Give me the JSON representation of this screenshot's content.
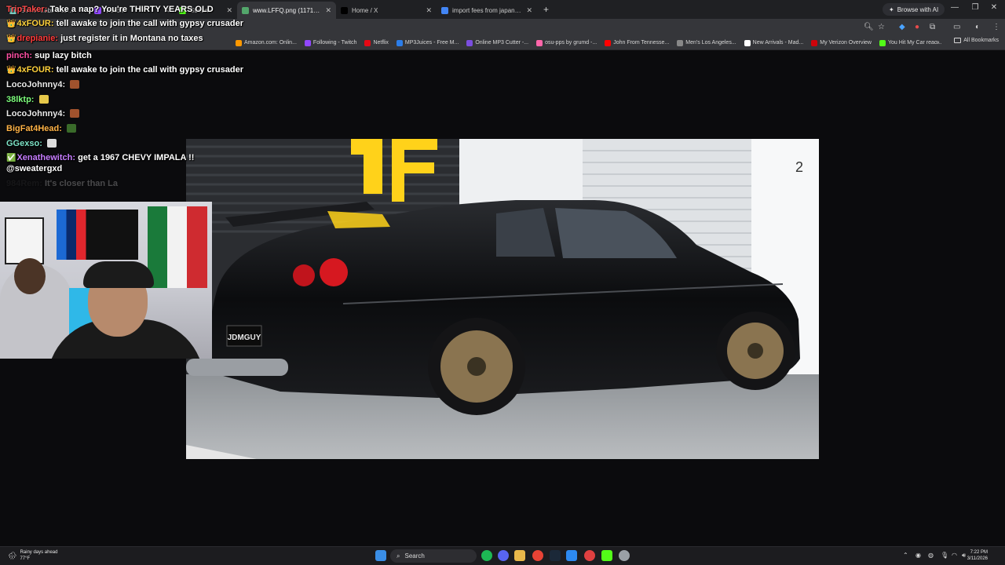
{
  "browser": {
    "tabs": [
      {
        "title": "StreamLabs Dashboard",
        "favicon_color": "#7fd3c8",
        "active": false
      },
      {
        "title": "Twitch",
        "favicon_color": "#9147ff",
        "active": false
      },
      {
        "title": "Stream",
        "favicon_color": "#53fc18",
        "active": false
      },
      {
        "title": "www.LFFQ.png (1171×593)",
        "favicon_color": "#53a66b",
        "active": true
      },
      {
        "title": "Home / X",
        "favicon_color": "#000000",
        "active": false
      },
      {
        "title": "import fees from japan to us - Google",
        "favicon_color": "#4285f4",
        "active": false
      }
    ],
    "new_tab_label": "+",
    "browse_ai_label": "Browse with AI",
    "bookmarks": [
      {
        "label": "Amazon.com: Onlin...",
        "color": "#ff9900"
      },
      {
        "label": "Following - Twitch",
        "color": "#9147ff"
      },
      {
        "label": "Netflix",
        "color": "#e50914"
      },
      {
        "label": "MP3Juices - Free M...",
        "color": "#2b7de9"
      },
      {
        "label": "Online MP3 Cutter -...",
        "color": "#7b4ee0"
      },
      {
        "label": "osu-pps by grumd -...",
        "color": "#ff66aa"
      },
      {
        "label": "John From Tennesse...",
        "color": "#ff0000"
      },
      {
        "label": "Men's Los Angeles...",
        "color": "#888888"
      },
      {
        "label": "New Arrivals - Mad...",
        "color": "#ffffff"
      },
      {
        "label": "My Verizon Overview",
        "color": "#cd040b"
      },
      {
        "label": "You Hit My Car reac...",
        "color": "#53fc18"
      }
    ],
    "all_bookmarks_label": "All Bookmarks"
  },
  "chat": {
    "messages": [
      {
        "user": "TripTaker",
        "user_color": "#ff4b4b",
        "badge": "",
        "text": "Take a nap? You're THIRTY YEARS OLD"
      },
      {
        "user": "4xFOUR",
        "user_color": "#ffd23c",
        "badge": "👑",
        "text": "tell awake to join the call with gypsy crusader"
      },
      {
        "user": "drepianie",
        "user_color": "#ff3b3b",
        "badge": "👑",
        "text": "just register it in Montana no taxes"
      },
      {
        "user": "pinch",
        "user_color": "#ff4fa3",
        "badge": "",
        "text": "sup lazy bitch"
      },
      {
        "user": "4xFOUR",
        "user_color": "#ffd23c",
        "badge": "👑",
        "text": "tell awake to join the call with gypsy crusader"
      },
      {
        "user": "LocoJohnny4",
        "user_color": "#e9e9e9",
        "badge": "",
        "text": ""
      },
      {
        "user": "38lktp",
        "user_color": "#7dff7d",
        "badge": "",
        "text": ""
      },
      {
        "user": "LocoJohnny4",
        "user_color": "#e9e9e9",
        "badge": "",
        "text": ""
      },
      {
        "user": "BigFat4Head",
        "user_color": "#ffb347",
        "badge": "",
        "text": ""
      },
      {
        "user": "GGexso",
        "user_color": "#7de3c7",
        "badge": "",
        "text": ""
      },
      {
        "user": "Xenathewitch",
        "user_color": "#c77dff",
        "badge": "✅",
        "text": "get a 1967 CHEVY IMPALA !!"
      },
      {
        "user": "",
        "user_color": "#ffffff",
        "badge": "",
        "text": "@sweatergxd"
      },
      {
        "user": "984Rem",
        "user_color": "#3a3a3a",
        "badge": "",
        "text": "It's closer than La"
      }
    ]
  },
  "photo": {
    "plate_text": "JDMGUY",
    "wall_number": "2"
  },
  "taskbar": {
    "weather_line1": "Rainy days ahead",
    "weather_line2": "77°F",
    "search_placeholder": "Search",
    "time": "7:22 PM",
    "date": "3/11/2026"
  }
}
